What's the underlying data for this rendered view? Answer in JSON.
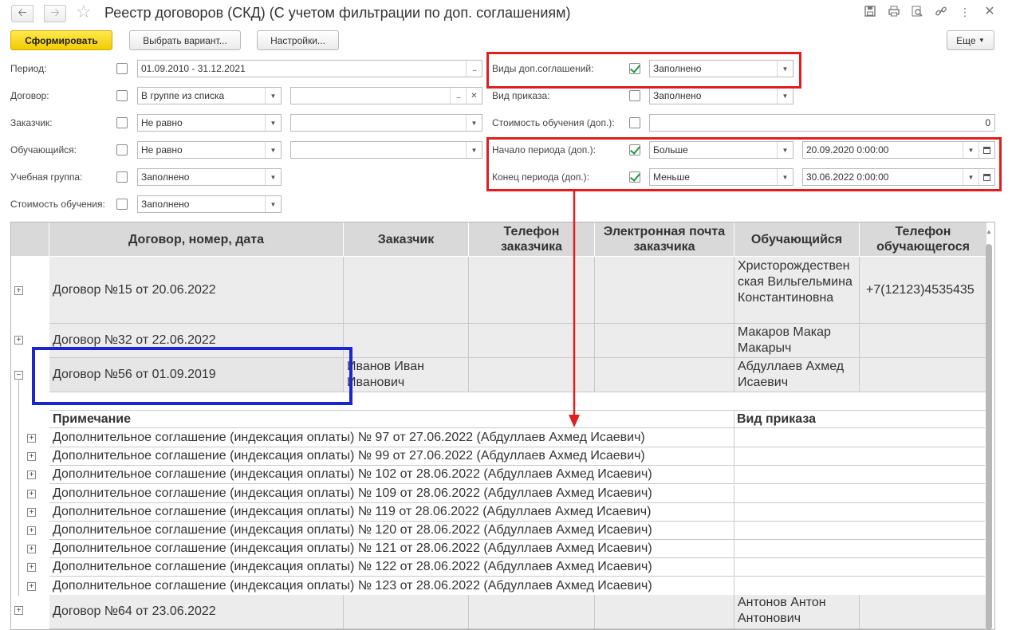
{
  "window": {
    "title": "Реестр договоров (СКД) (С учетом фильтрации по доп. соглашениям)"
  },
  "toolbar": {
    "generate": "Сформировать",
    "choose_variant": "Выбрать вариант...",
    "settings": "Настройки...",
    "more": "Еще"
  },
  "filters": {
    "period": {
      "label": "Период:",
      "value": "01.09.2010 - 31.12.2021",
      "checked": false
    },
    "contract": {
      "label": "Договор:",
      "condition": "В группе из списка",
      "value": "",
      "checked": false
    },
    "customer": {
      "label": "Заказчик:",
      "condition": "Не равно",
      "value": "",
      "checked": false
    },
    "student": {
      "label": "Обучающийся:",
      "condition": "Не равно",
      "value": "",
      "checked": false
    },
    "group": {
      "label": "Учебная группа:",
      "condition": "Заполнено",
      "checked": false
    },
    "cost": {
      "label": "Стоимость обучения:",
      "condition": "Заполнено",
      "checked": false
    },
    "addendum_types": {
      "label": "Виды доп.соглашений:",
      "condition": "Заполнено",
      "checked": true
    },
    "order_type": {
      "label": "Вид приказа:",
      "condition": "Заполнено",
      "checked": false
    },
    "cost_add": {
      "label": "Стоимость обучения (доп.):",
      "value": "0",
      "checked": false
    },
    "period_start": {
      "label": "Начало периода (доп.):",
      "condition": "Больше",
      "value": "20.09.2020  0:00:00",
      "checked": true
    },
    "period_end": {
      "label": "Конец периода (доп.):",
      "condition": "Меньше",
      "value": "30.06.2022  0:00:00",
      "checked": true
    }
  },
  "report": {
    "columns": {
      "contract": "Договор, номер, дата",
      "customer": "Заказчик",
      "customer_phone": "Телефон заказчика",
      "customer_email": "Электронная почта заказчика",
      "student": "Обучающийся",
      "student_phone": "Телефон обучающегося"
    },
    "rows": [
      {
        "contract": "Договор №15 от 20.06.2022",
        "customer": "",
        "student": "Христорождественская Вильгельмина Константиновна",
        "student_phone": "+7(12123)4535435"
      },
      {
        "contract": "Договор №32 от 22.06.2022",
        "customer": "",
        "student": "Макаров Макар Макарыч",
        "student_phone": ""
      },
      {
        "contract": "Договор №56 от 01.09.2019",
        "customer": "Иванов Иван Иванович",
        "student": "Абдуллаев Ахмед Исаевич",
        "student_phone": ""
      },
      {
        "contract": "Договор №64 от 23.06.2022",
        "customer": "",
        "student": "Антонов Антон Антонович",
        "student_phone": ""
      }
    ],
    "sub_headers": {
      "note": "Примечание",
      "order_type": "Вид приказа"
    },
    "addenda": [
      "Дополнительное соглашение (индексация оплаты) № 97 от 27.06.2022 (Абдуллаев Ахмед Исаевич)",
      "Дополнительное соглашение (индексация оплаты) № 99 от 27.06.2022 (Абдуллаев Ахмед Исаевич)",
      "Дополнительное соглашение (индексация оплаты) № 102 от 28.06.2022 (Абдуллаев Ахмед Исаевич)",
      "Дополнительное соглашение (индексация оплаты) № 109 от 28.06.2022 (Абдуллаев Ахмед Исаевич)",
      "Дополнительное соглашение (индексация оплаты) № 119 от 28.06.2022 (Абдуллаев Ахмед Исаевич)",
      "Дополнительное соглашение (индексация оплаты) № 120 от 28.06.2022 (Абдуллаев Ахмед Исаевич)",
      "Дополнительное соглашение (индексация оплаты) № 121 от 28.06.2022 (Абдуллаев Ахмед Исаевич)",
      "Дополнительное соглашение (индексация оплаты) № 122 от 28.06.2022 (Абдуллаев Ахмед Исаевич)",
      "Дополнительное соглашение (индексация оплаты) № 123 от 28.06.2022 (Абдуллаев Ахмед Исаевич)"
    ]
  },
  "colors": {
    "primary_button": "#f5d000",
    "annotation_red": "#e21d1d",
    "annotation_blue": "#1c24d6",
    "checkbox_green": "#1f9a3c",
    "header_bg": "#d9d9d9",
    "row_bg": "#ececec"
  }
}
